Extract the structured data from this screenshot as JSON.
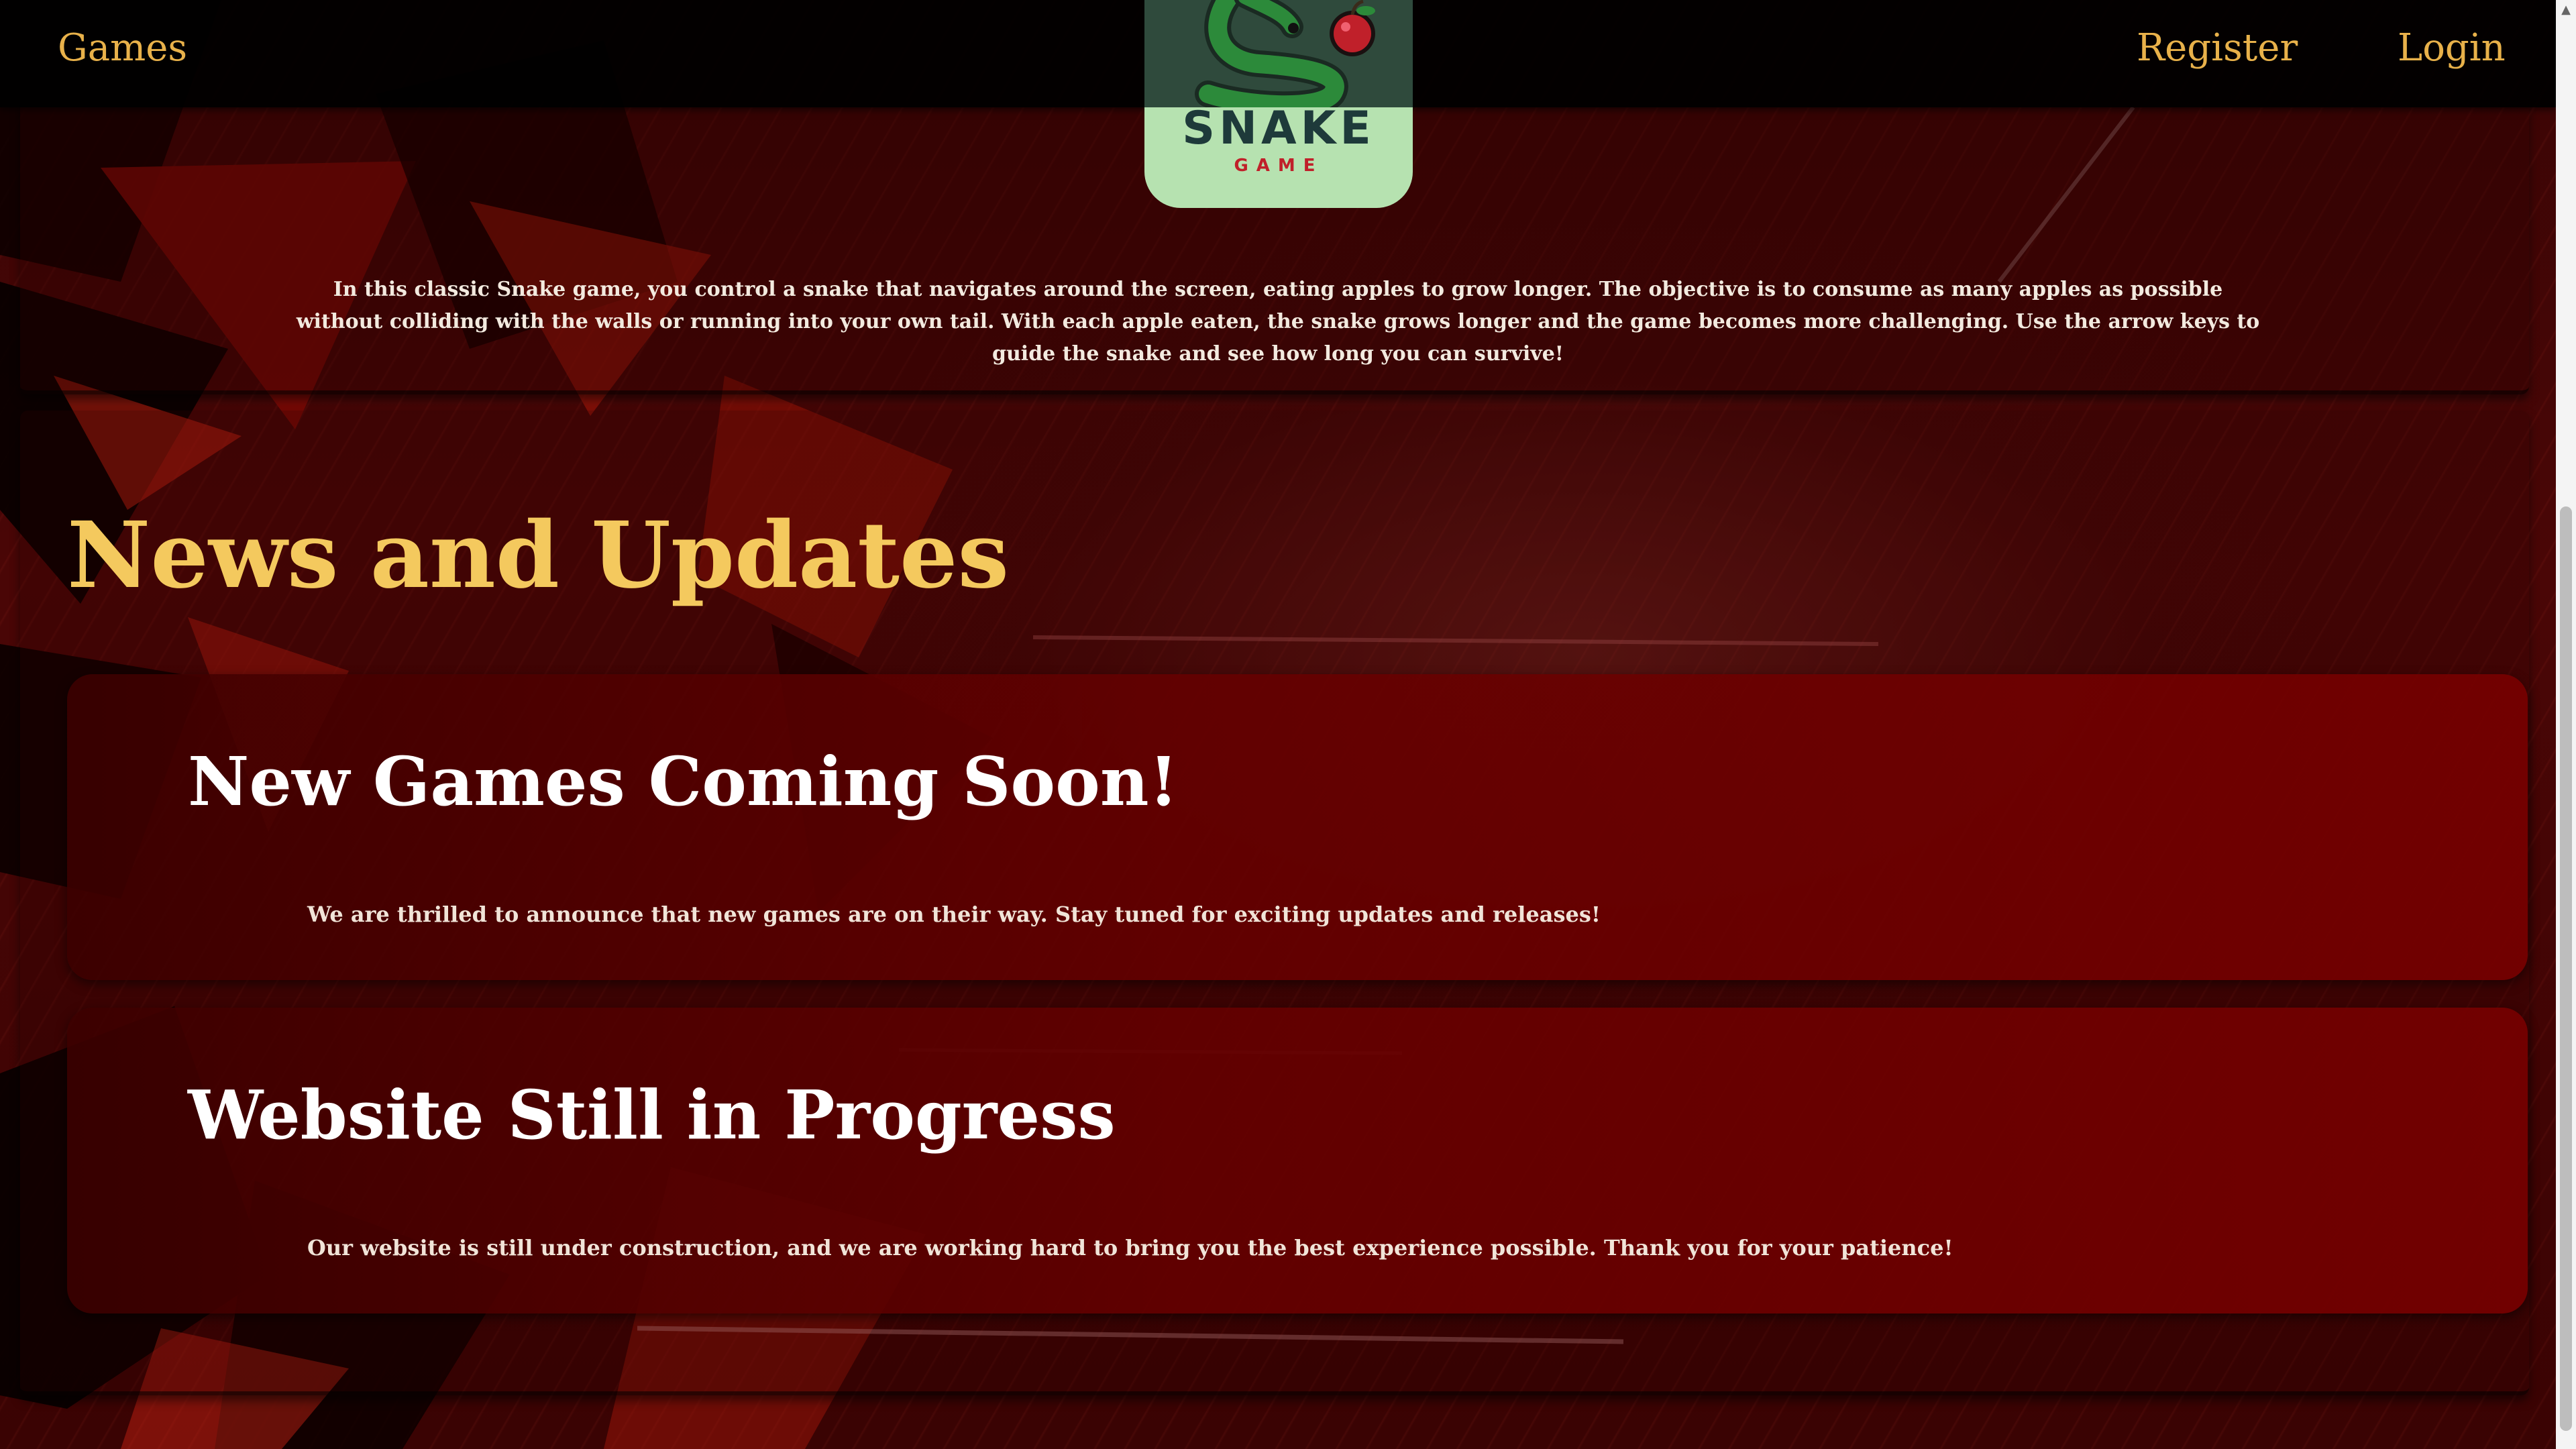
{
  "nav": {
    "games_label": "Games",
    "register_label": "Register",
    "login_label": "Login"
  },
  "logo": {
    "word": "SNAKE",
    "sub": "GAME",
    "icon": "snake-apple-logo"
  },
  "intro": {
    "text": "In this classic Snake game, you control a snake that navigates around the screen, eating apples to grow longer. The objective is to consume as many apples as possible without colliding with the walls or running into your own tail. With each apple eaten, the snake grows longer and the game becomes more challenging. Use the arrow keys to guide the snake and see how long you can survive!"
  },
  "news": {
    "heading": "News and Updates",
    "items": [
      {
        "title": "New Games Coming Soon!",
        "body": "We are thrilled to announce that new games are on their way. Stay tuned for exciting updates and releases!"
      },
      {
        "title": "Website Still in Progress",
        "body": "Our website is still under construction, and we are working hard to bring you the best experience possible. Thank you for your patience!"
      }
    ]
  },
  "colors": {
    "accent": "#e8b14a",
    "heading": "#f4c95e",
    "card": "#780000",
    "topbar": "#000000"
  },
  "scrollbar": {
    "up_icon": "scroll-up-arrow-icon"
  }
}
